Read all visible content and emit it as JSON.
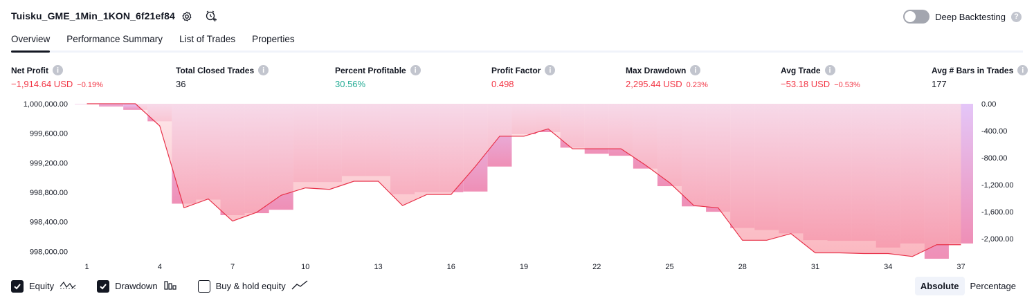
{
  "header": {
    "title": "Tuisku_GME_1Min_1KON_6f21ef84",
    "settings_icon": "gear-icon",
    "add_alert_icon": "alarm-clock-plus-icon",
    "deep_backtesting_label": "Deep Backtesting",
    "deep_backtesting_enabled": false,
    "help_glyph": "?"
  },
  "tabs": [
    {
      "label": "Overview",
      "active": true
    },
    {
      "label": "Performance Summary",
      "active": false
    },
    {
      "label": "List of Trades",
      "active": false
    },
    {
      "label": "Properties",
      "active": false
    }
  ],
  "metrics": {
    "net_profit": {
      "label": "Net Profit",
      "value": "−1,914.64 USD",
      "pct": "−0.19%"
    },
    "total_closed_trades": {
      "label": "Total Closed Trades",
      "value": "36"
    },
    "percent_profitable": {
      "label": "Percent Profitable",
      "value": "30.56%"
    },
    "profit_factor": {
      "label": "Profit Factor",
      "value": "0.498"
    },
    "max_drawdown": {
      "label": "Max Drawdown",
      "value": "2,295.44 USD",
      "pct": "0.23%"
    },
    "avg_trade": {
      "label": "Avg Trade",
      "value": "−53.18 USD",
      "pct": "−0.53%"
    },
    "avg_bars": {
      "label": "Avg # Bars in Trades",
      "value": "177"
    }
  },
  "colors": {
    "loss_red": "#f23645",
    "profit_green": "#22ab94",
    "drawdown_purple": "#d69cf5",
    "equity_fill": "#f7a6b4",
    "equity_line": "#e8324a"
  },
  "chart_data": {
    "type": "area",
    "x_ticks": [
      "1",
      "4",
      "7",
      "10",
      "13",
      "16",
      "19",
      "22",
      "25",
      "28",
      "31",
      "34",
      "37"
    ],
    "y_left_ticks": [
      "1,000,000.00",
      "999,600.00",
      "999,200.00",
      "998,800.00",
      "998,400.00",
      "998,000.00"
    ],
    "y_right_ticks": [
      "0.00",
      "-400.00",
      "-800.00",
      "-1,200.00",
      "-1,600.00",
      "-2,000.00"
    ],
    "y_left_range": [
      997900,
      1000000
    ],
    "y_right_range": [
      -2295.44,
      0
    ],
    "series": [
      {
        "name": "Equity",
        "x": [
          1,
          2,
          3,
          4,
          5,
          6,
          7,
          8,
          9,
          10,
          11,
          12,
          13,
          14,
          15,
          16,
          17,
          18,
          19,
          20,
          21,
          22,
          23,
          24,
          25,
          26,
          27,
          28,
          29,
          30,
          31,
          32,
          33,
          34,
          35,
          36,
          37
        ],
        "values": [
          1000000,
          1000000,
          1000000,
          999700,
          998590,
          998710,
          998410,
          998530,
          998760,
          998860,
          998840,
          998950,
          998950,
          998620,
          998770,
          998770,
          999150,
          999560,
          999560,
          999660,
          999390,
          999390,
          999390,
          999170,
          998930,
          998620,
          998590,
          998150,
          998150,
          998240,
          997980,
          997980,
          997970,
          997970,
          997930,
          998090,
          998090
        ]
      },
      {
        "name": "Drawdown",
        "x": [
          1,
          2,
          3,
          4,
          5,
          6,
          7,
          8,
          9,
          10,
          11,
          12,
          13,
          14,
          15,
          16,
          17,
          18,
          19,
          20,
          21,
          22,
          23,
          24,
          25,
          26,
          27,
          28,
          29,
          30,
          31,
          32,
          33,
          34,
          35,
          36,
          37
        ],
        "values": [
          0,
          -40,
          -90,
          -260,
          -1480,
          -1420,
          -1650,
          -1620,
          -1570,
          -1160,
          -1160,
          -1070,
          -1070,
          -1340,
          -1310,
          -1310,
          -1300,
          -930,
          -450,
          -420,
          -650,
          -740,
          -770,
          -960,
          -1220,
          -1520,
          -1600,
          -1840,
          -1870,
          -1920,
          -2020,
          -2030,
          -2030,
          -2130,
          -2070,
          -2295.44,
          -2070
        ]
      }
    ],
    "legend": {
      "equity": {
        "label": "Equity",
        "checked": true,
        "icon": "wave-chart-icon"
      },
      "drawdown": {
        "label": "Drawdown",
        "checked": true,
        "icon": "bar-chart-icon"
      },
      "buy_hold": {
        "label": "Buy & hold equity",
        "checked": false,
        "icon": "line-chart-icon"
      }
    },
    "scale_modes": [
      {
        "label": "Absolute",
        "active": true
      },
      {
        "label": "Percentage",
        "active": false
      }
    ]
  }
}
